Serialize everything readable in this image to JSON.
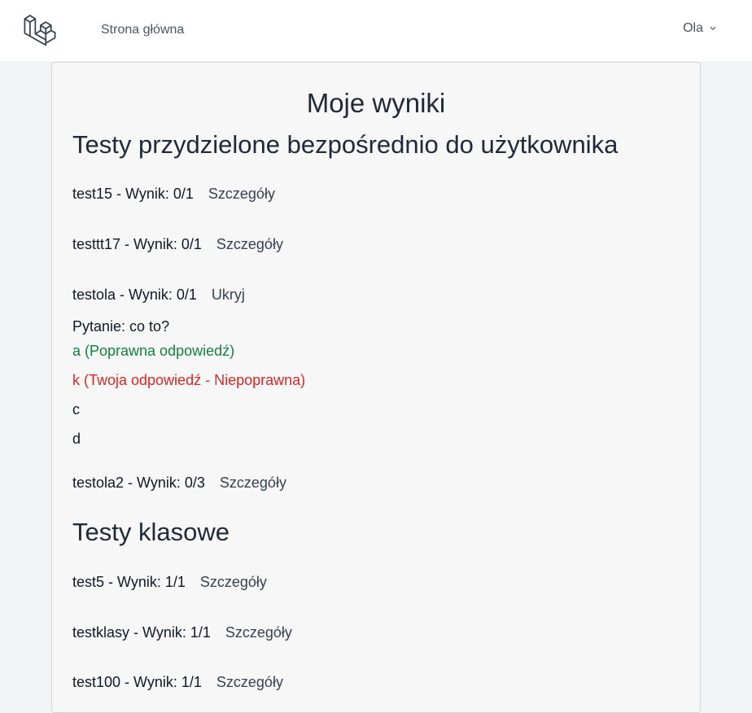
{
  "nav": {
    "home_label": "Strona główna",
    "user_name": "Ola"
  },
  "page": {
    "title": "Moje wyniki"
  },
  "direct_section": {
    "title": "Testy przydzielone bezpośrednio do użytkownika",
    "rows": [
      {
        "text": "test15 - Wynik: 0/1",
        "link": "Szczegóły"
      },
      {
        "text": "testtt17 - Wynik: 0/1",
        "link": "Szczegóły"
      },
      {
        "text": "testola - Wynik: 0/1",
        "link": "Ukryj"
      },
      {
        "text": "testola2 - Wynik: 0/3",
        "link": "Szczegóły"
      }
    ],
    "details": {
      "question": "Pytanie: co to?",
      "answers": [
        {
          "text": "a (Poprawna odpowiedź)",
          "status": "correct"
        },
        {
          "text": "k (Twoja odpowiedź - Niepoprawna)",
          "status": "wrong"
        },
        {
          "text": "c",
          "status": "neutral"
        },
        {
          "text": "d",
          "status": "neutral"
        }
      ]
    }
  },
  "class_section": {
    "title": "Testy klasowe",
    "rows": [
      {
        "text": "test5 - Wynik: 1/1",
        "link": "Szczegóły"
      },
      {
        "text": "testklasy - Wynik: 1/1",
        "link": "Szczegóły"
      },
      {
        "text": "test100 - Wynik: 1/1",
        "link": "Szczegóły"
      }
    ]
  },
  "colors": {
    "correct": "#15803d",
    "wrong": "#dc2626",
    "logo": "#374151"
  }
}
